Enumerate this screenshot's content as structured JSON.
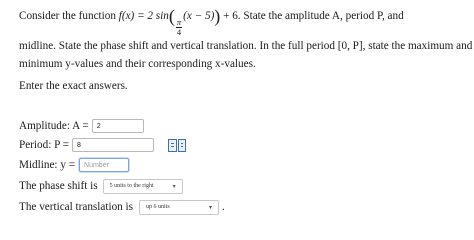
{
  "problem": {
    "line1_intro": "Consider the function",
    "function_lhs": "f(x) = 2 sin",
    "frac_num": "π",
    "frac_den": "4",
    "function_inner": "(x − 5)",
    "function_tail": "+ 6. State the amplitude A, period P, and",
    "line2": "midline. State the phase shift and vertical translation. In the full period [0, P], state the maximum and",
    "line3": "minimum y-values and their corresponding x-values."
  },
  "instruction": "Enter the exact answers.",
  "amplitude": {
    "label": "Amplitude: A =",
    "value": "2"
  },
  "period": {
    "label": "Period: P =",
    "value": "8"
  },
  "midline": {
    "label": "Midline: y =",
    "placeholder": "Number"
  },
  "phase_shift": {
    "label": "The phase shift is",
    "selected": "5 units to the right"
  },
  "vertical_translation": {
    "label": "The vertical translation is",
    "selected": "up 6 units",
    "suffix": "."
  },
  "icons": {
    "preview": "preview-icon"
  },
  "colors": {
    "focus_border": "#7aa5e0",
    "icon_blue": "#3a6fb5"
  }
}
